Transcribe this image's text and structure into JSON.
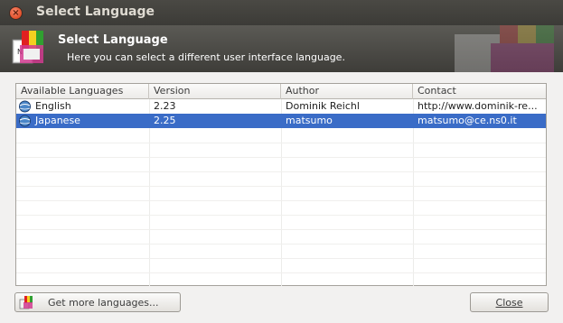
{
  "window": {
    "title": "Select Language",
    "close_glyph": "×"
  },
  "banner": {
    "title": "Select Language",
    "subtitle": "Here you can select a different user interface language."
  },
  "table": {
    "columns": [
      "Available Languages",
      "Version",
      "Author",
      "Contact"
    ],
    "rows": [
      {
        "language": "English",
        "version": "2.23",
        "author": "Dominik Reichl",
        "contact": "http://www.dominik-re...",
        "selected": false
      },
      {
        "language": "Japanese",
        "version": "2.25",
        "author": "matsumo",
        "contact": "matsumo@ce.ns0.it",
        "selected": true
      }
    ],
    "selection_color": "#3a6cc7"
  },
  "buttons": {
    "get_more": "Get more languages...",
    "close": "Close"
  },
  "icons": {
    "app_logo": "keepass-language-logo-icon",
    "row_icon": "globe-icon",
    "get_more_icon": "language-flags-icon"
  }
}
